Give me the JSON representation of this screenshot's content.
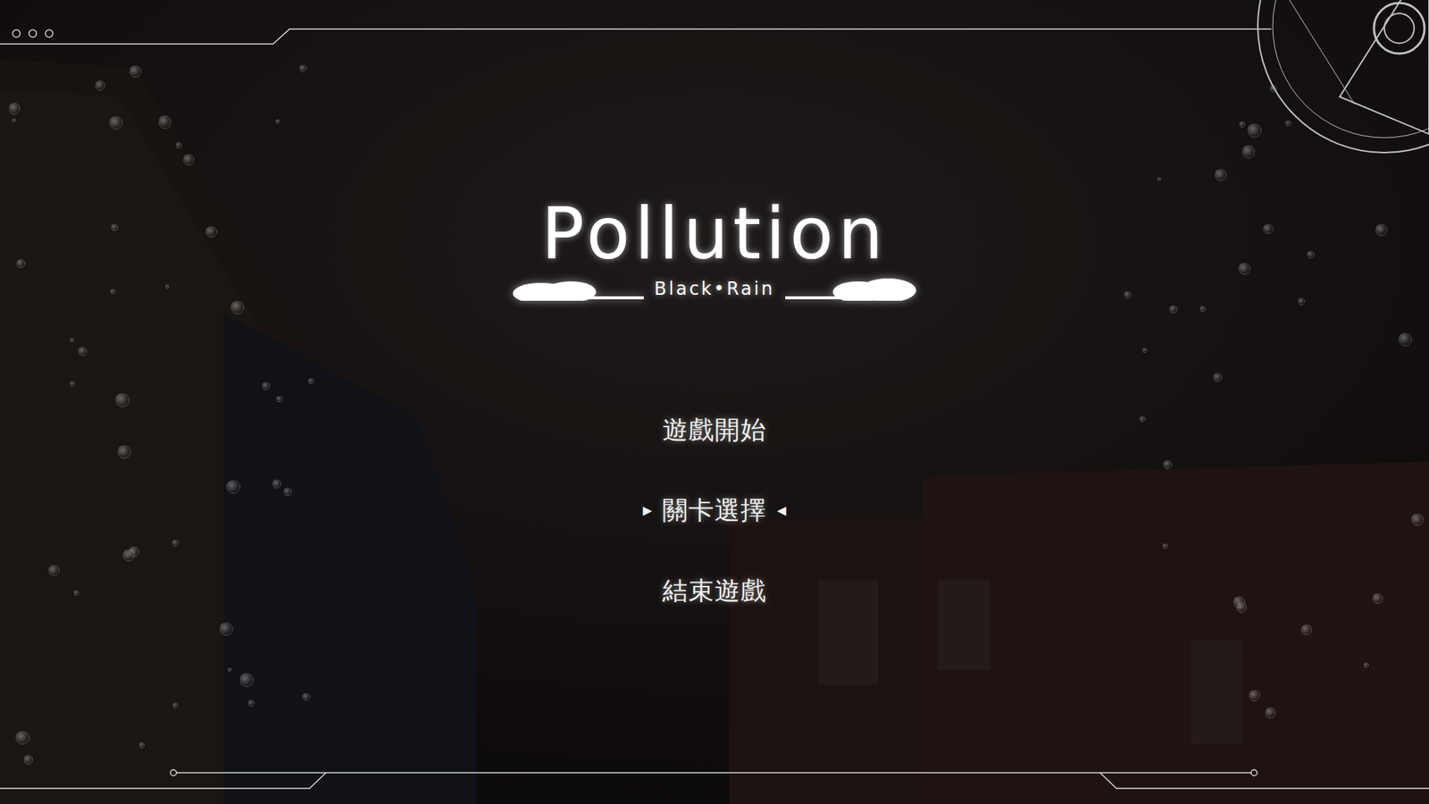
{
  "title": {
    "text": "Pollution",
    "subtitle": "Black•Rain"
  },
  "menu": [
    {
      "label": "遊戲開始",
      "selected": false
    },
    {
      "label": "關卡選擇",
      "selected": true
    },
    {
      "label": "結束遊戲",
      "selected": false
    }
  ],
  "cursor": {
    "left": "▶",
    "right": "◀"
  }
}
